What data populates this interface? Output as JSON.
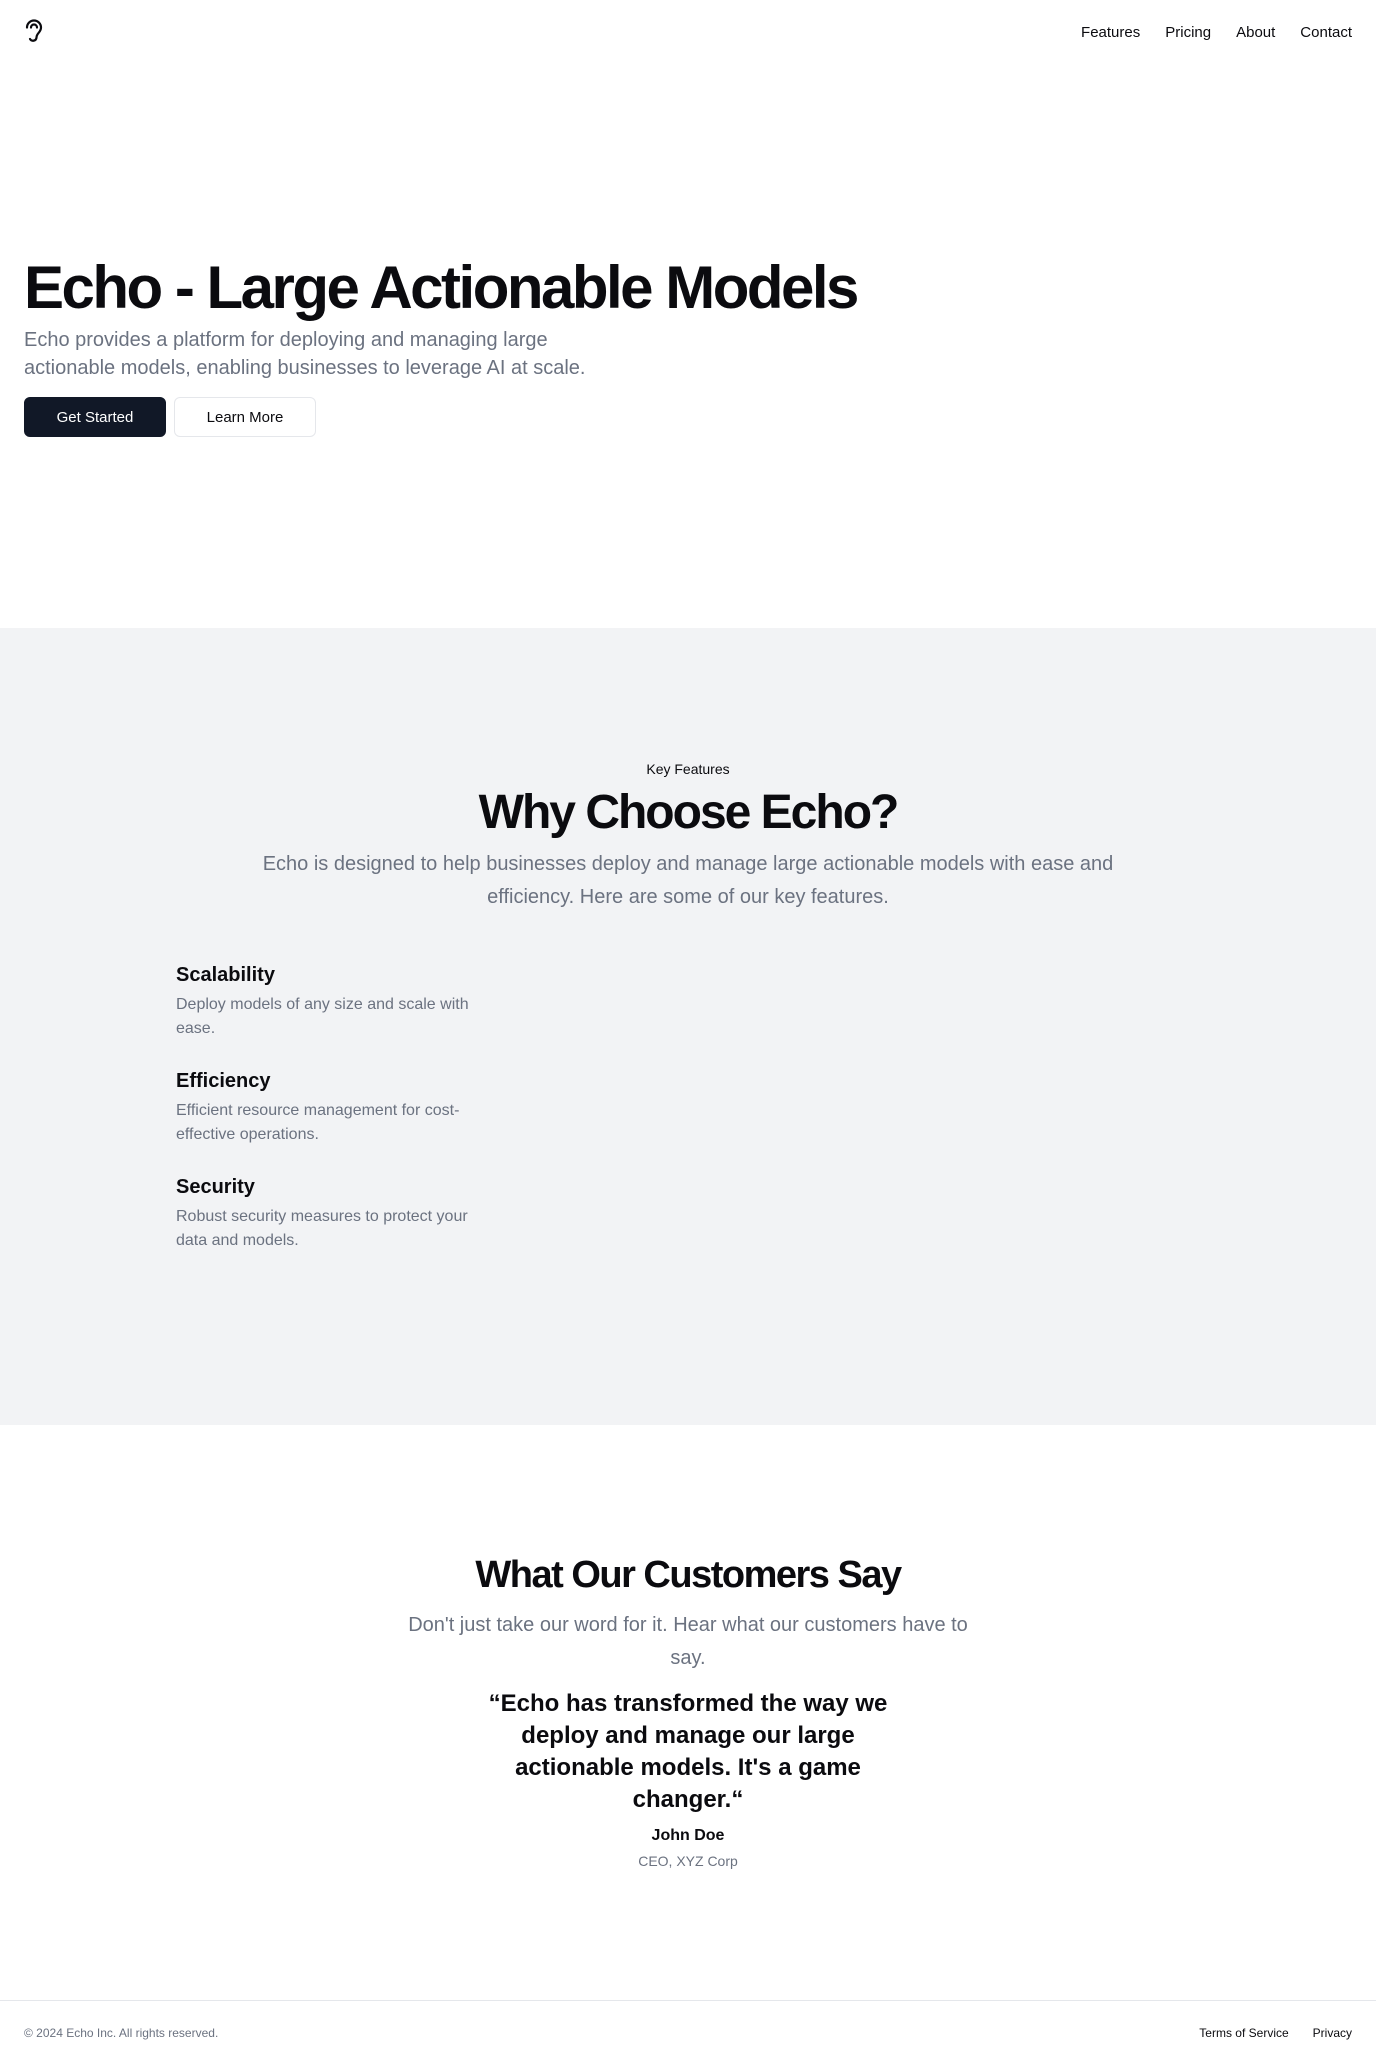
{
  "header": {
    "logo_icon": "ear-icon",
    "nav": [
      {
        "label": "Features"
      },
      {
        "label": "Pricing"
      },
      {
        "label": "About"
      },
      {
        "label": "Contact"
      }
    ]
  },
  "hero": {
    "title": "Echo - Large Actionable Models",
    "subtitle": "Echo provides a platform for deploying and managing large actionable models, enabling businesses to leverage AI at scale.",
    "primary_button": "Get Started",
    "secondary_button": "Learn More"
  },
  "features": {
    "eyebrow": "Key Features",
    "title": "Why Choose Echo?",
    "lead": "Echo is designed to help businesses deploy and manage large actionable models with ease and efficiency. Here are some of our key features.",
    "items": [
      {
        "title": "Scalability",
        "text": "Deploy models of any size and scale with ease."
      },
      {
        "title": "Efficiency",
        "text": "Efficient resource management for cost-effective operations."
      },
      {
        "title": "Security",
        "text": "Robust security measures to protect your data and models."
      }
    ]
  },
  "testimonials": {
    "title": "What Our Customers Say",
    "lead": "Don't just take our word for it. Hear what our customers have to say.",
    "quote": "“Echo has transformed the way we deploy and manage our large actionable models. It's a game changer.“",
    "author": "John Doe",
    "role": "CEO, XYZ Corp"
  },
  "footer": {
    "copyright": "© 2024 Echo Inc. All rights reserved.",
    "links": [
      {
        "label": "Terms of Service"
      },
      {
        "label": "Privacy"
      }
    ]
  },
  "colors": {
    "primary_button_bg": "#111827",
    "section_bg": "#f2f3f5",
    "muted_text": "#6b7280"
  }
}
